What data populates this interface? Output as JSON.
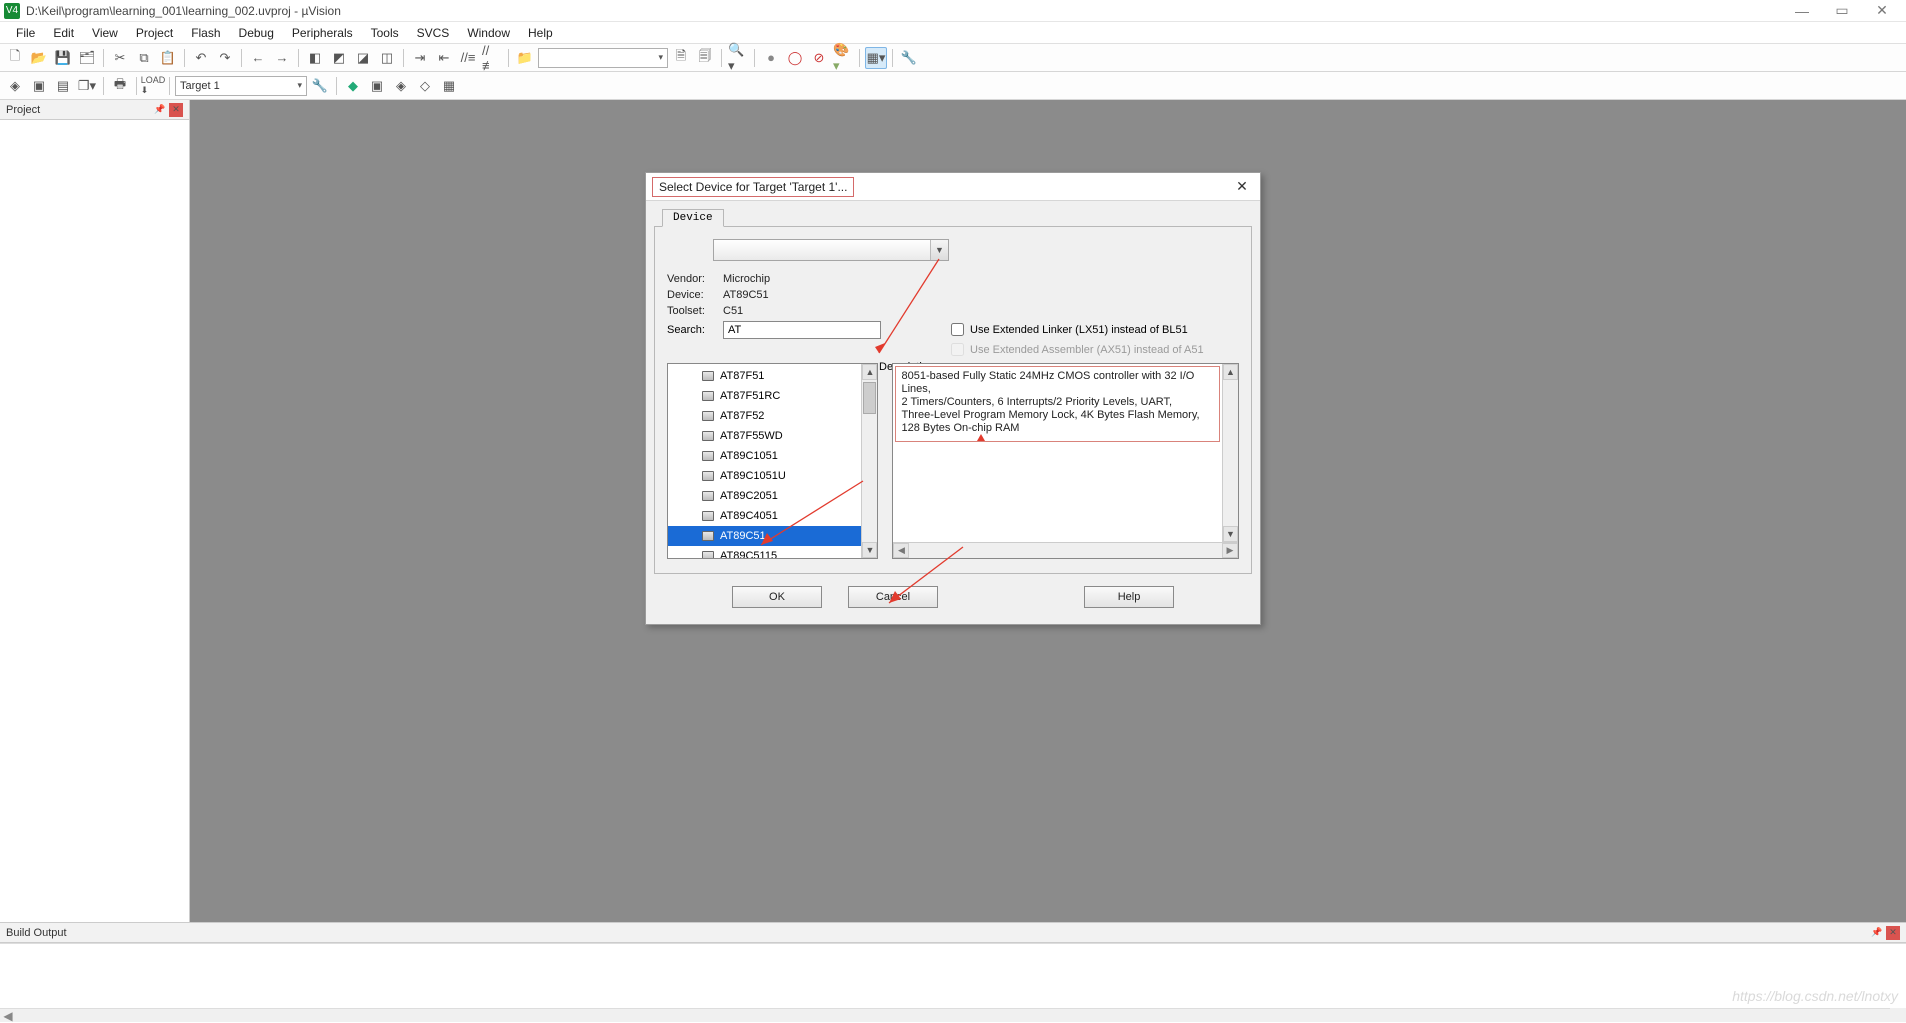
{
  "titlebar": {
    "title": "D:\\Keil\\program\\learning_001\\learning_002.uvproj - µVision",
    "app_badge": "V4"
  },
  "menu": {
    "items": [
      "File",
      "Edit",
      "View",
      "Project",
      "Flash",
      "Debug",
      "Peripherals",
      "Tools",
      "SVCS",
      "Window",
      "Help"
    ]
  },
  "toolbar2": {
    "target_label": "Target 1"
  },
  "panels": {
    "project_title": "Project",
    "build_output_title": "Build Output"
  },
  "dialog": {
    "title": "Select Device for Target 'Target 1'...",
    "tab": "Device",
    "vendor_label": "Vendor:",
    "vendor_value": "Microchip",
    "device_label": "Device:",
    "device_value": "AT89C51",
    "toolset_label": "Toolset:",
    "toolset_value": "C51",
    "search_label": "Search:",
    "search_value": "AT",
    "chk_linker": "Use Extended Linker (LX51) instead of BL51",
    "chk_assembler": "Use Extended Assembler (AX51) instead of A51",
    "description_label": "Description:",
    "devices": [
      "AT87F51",
      "AT87F51RC",
      "AT87F52",
      "AT87F55WD",
      "AT89C1051",
      "AT89C1051U",
      "AT89C2051",
      "AT89C4051",
      "AT89C51",
      "AT89C5115"
    ],
    "selected_device_index": 8,
    "description_lines": [
      "8051-based Fully Static 24MHz CMOS controller with 32  I/O Lines,",
      "2 Timers/Counters, 6 Interrupts/2 Priority Levels, UART,",
      "Three-Level Program Memory Lock, 4K Bytes Flash Memory,",
      "128 Bytes On-chip RAM"
    ],
    "btn_ok": "OK",
    "btn_cancel": "Cancel",
    "btn_help": "Help"
  },
  "watermark": "https://blog.csdn.net/lnotxy"
}
